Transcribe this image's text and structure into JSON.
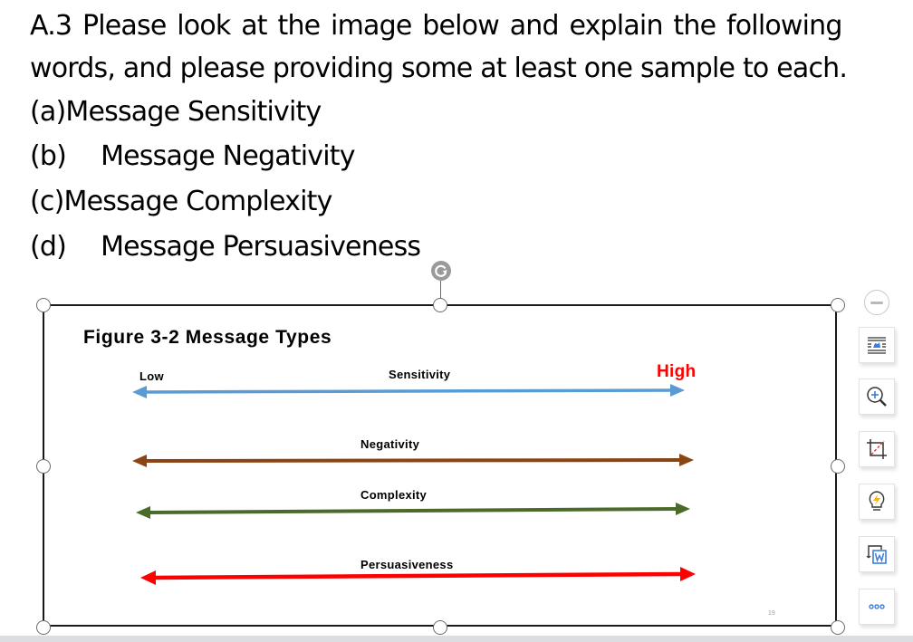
{
  "question": {
    "line1": "A.3 Please look at the image below and explain the following",
    "line2": "words, and please providing some at least one sample to each.",
    "items": [
      {
        "marker": "(a)",
        "text": "Message Sensitivity"
      },
      {
        "marker": "(b)",
        "text": "Message Negativity"
      },
      {
        "marker": "(c)",
        "text": "Message Complexity"
      },
      {
        "marker": "(d)",
        "text": "Message Persuasiveness"
      }
    ]
  },
  "figure": {
    "title": "Figure 3-2 Message Types",
    "low_label": "Low",
    "high_label": "High",
    "page_number": "19",
    "scales": [
      {
        "name": "Sensitivity",
        "color": "#5b9bd5"
      },
      {
        "name": "Negativity",
        "color": "#8b4513"
      },
      {
        "name": "Complexity",
        "color": "#4a6b2a"
      },
      {
        "name": "Persuasiveness",
        "color": "#ff0000"
      }
    ],
    "high_color": "#ff0000"
  },
  "toolbar": {
    "buttons": [
      {
        "icon": "collapse-icon",
        "tooltip": "Collapse"
      },
      {
        "icon": "text-wrap-icon",
        "tooltip": "Wrap Text"
      },
      {
        "icon": "zoom-in-icon",
        "tooltip": "Zoom In"
      },
      {
        "icon": "crop-icon",
        "tooltip": "Crop"
      },
      {
        "icon": "smart-idea-icon",
        "tooltip": "Smart"
      },
      {
        "icon": "convert-word-icon",
        "tooltip": "Convert to Word"
      },
      {
        "icon": "more-icon",
        "tooltip": "More"
      }
    ]
  }
}
